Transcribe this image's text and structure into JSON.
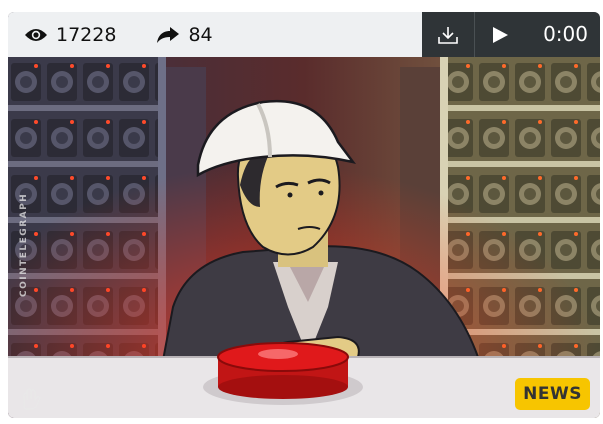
{
  "stats": {
    "views": "17228",
    "shares": "84"
  },
  "player": {
    "time": "0:00"
  },
  "image": {
    "watermark": "COINTELEGRAPH",
    "badge": "NEWS"
  },
  "icons": [
    "eye-icon",
    "share-arrow-icon",
    "download-icon",
    "play-icon",
    "logo-hand-icon"
  ],
  "colors": {
    "topbar": "#eef0f2",
    "controls": "#2f3437",
    "badge": "#f7c500",
    "button_red": "#e0191b"
  }
}
